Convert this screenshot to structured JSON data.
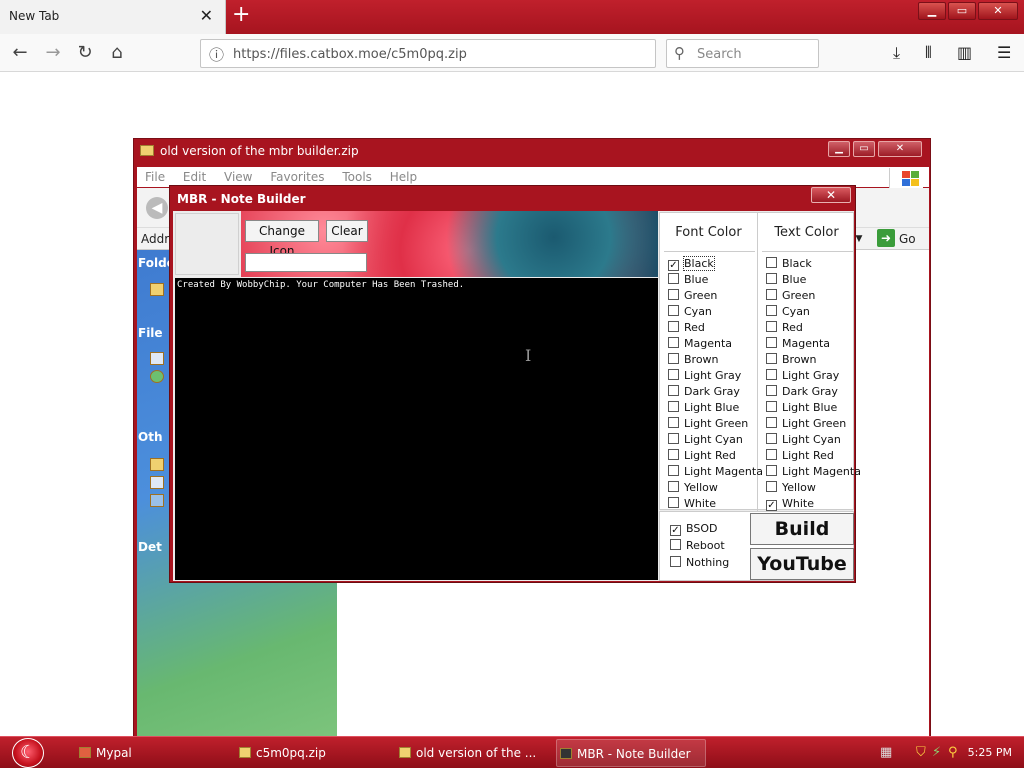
{
  "browser": {
    "tab_title": "New Tab",
    "tab_close": "✕",
    "new_tab": "+",
    "url": "https://files.catbox.moe/c5m0pq.zip",
    "search_placeholder": "Search"
  },
  "explorer": {
    "title": "old version of the mbr builder.zip",
    "menu": [
      "File",
      "Edit",
      "View",
      "Favorites",
      "Tools",
      "Help"
    ],
    "address_label": "Addr",
    "go_label": "Go",
    "sidebar_heads": [
      "Folde",
      "File",
      "Oth",
      "Det"
    ]
  },
  "mbr": {
    "title": "MBR - Note Builder",
    "close": "✕",
    "change_icon": "Change Icon",
    "clear": "Clear",
    "name_value": "",
    "console_text": "Created By WobbyChip. Your Computer Has Been Trashed.",
    "font_color_head": "Font Color",
    "text_color_head": "Text Color",
    "colors": [
      "Black",
      "Blue",
      "Green",
      "Cyan",
      "Red",
      "Magenta",
      "Brown",
      "Light Gray",
      "Dark Gray",
      "Light Blue",
      "Light Green",
      "Light Cyan",
      "Light Red",
      "Light Magenta",
      "Yellow",
      "White"
    ],
    "font_color_selected": "Black",
    "text_color_selected": "White",
    "actions": [
      "BSOD",
      "Reboot",
      "Nothing"
    ],
    "action_selected": "BSOD",
    "build": "Build",
    "youtube": "YouTube"
  },
  "taskbar": {
    "items": [
      {
        "label": "Mypal"
      },
      {
        "label": "c5m0pq.zip"
      },
      {
        "label": "old version of the ..."
      },
      {
        "label": "MBR - Note Builder"
      }
    ],
    "clock": "5:25 PM"
  }
}
